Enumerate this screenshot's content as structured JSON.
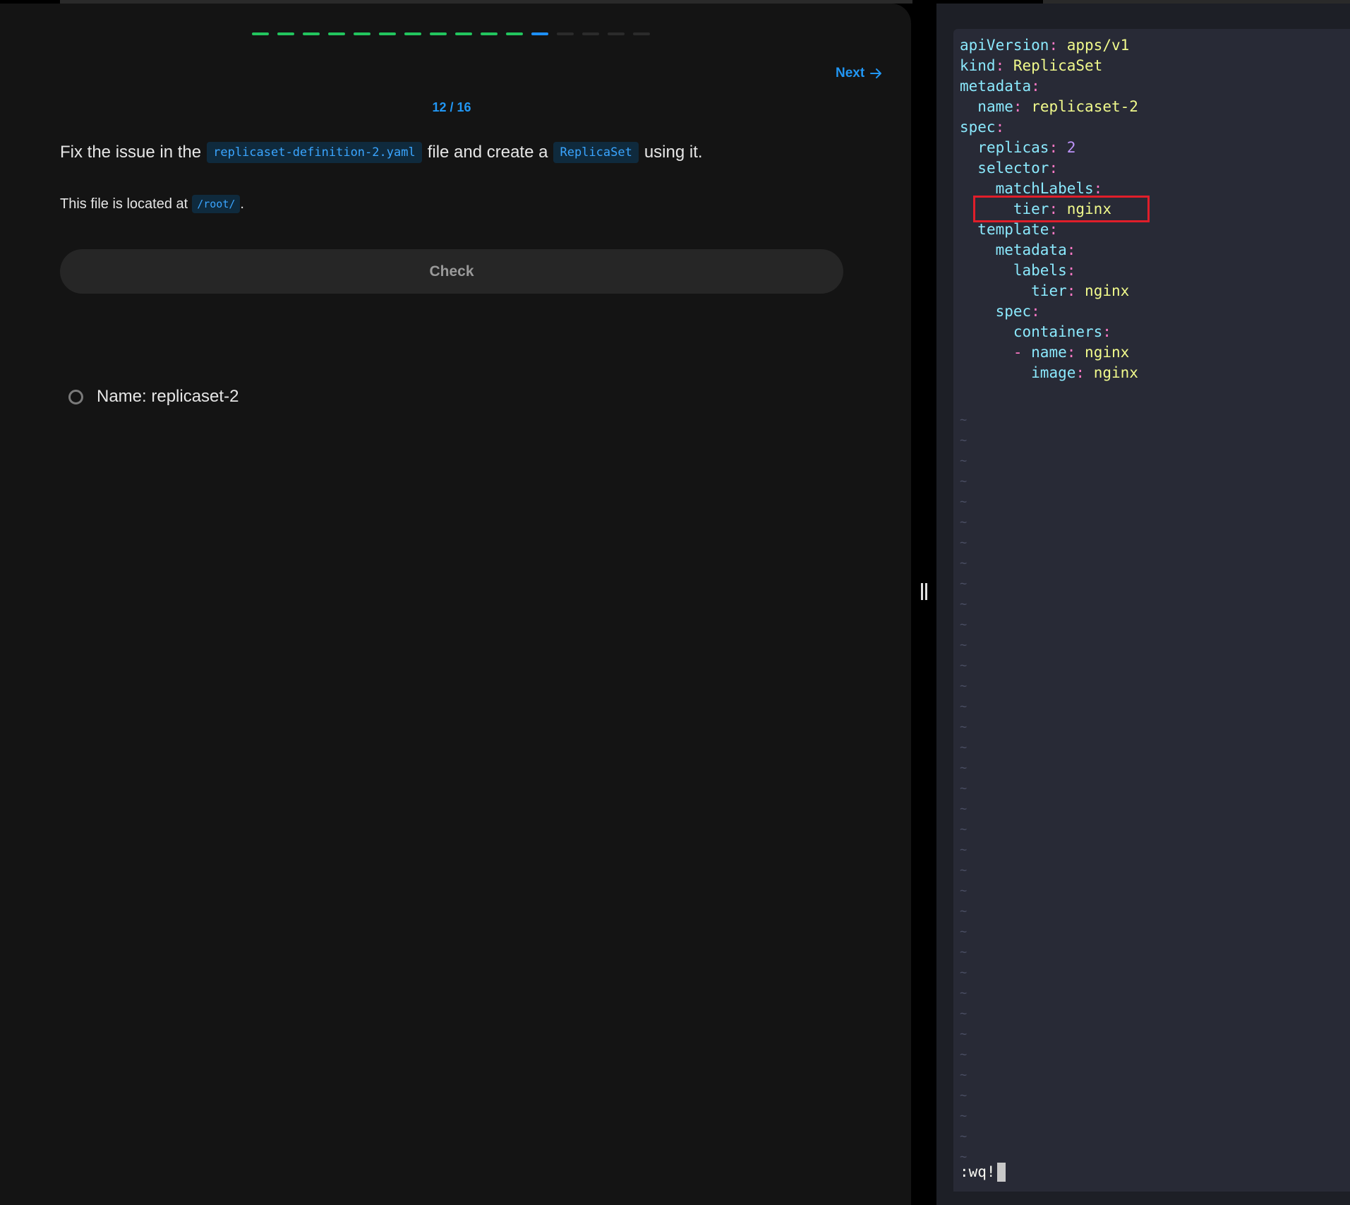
{
  "quiz": {
    "progress": {
      "total": 16,
      "completed": 11,
      "current": 12,
      "colors": {
        "done": "#22c55e",
        "current": "#1e90ff",
        "pending": "#2b2b2b"
      }
    },
    "next_label": "Next",
    "counter": "12 / 16",
    "question": {
      "prefix": "Fix the issue in the",
      "file_code": "replicaset-definition-2.yaml",
      "middle": "file and create a",
      "kind_code": "ReplicaSet",
      "suffix": "using it."
    },
    "location": {
      "prefix": "This file is located at",
      "path_code": "/root/",
      "suffix": "."
    },
    "check_label": "Check",
    "tasks": [
      {
        "label": "Name: replicaset-2",
        "status": "pending"
      }
    ]
  },
  "editor": {
    "lines": [
      {
        "indent": "",
        "key": "apiVersion",
        "value": "apps/v1",
        "value_type": "string"
      },
      {
        "indent": "",
        "key": "kind",
        "value": "ReplicaSet",
        "value_type": "string"
      },
      {
        "indent": "",
        "key": "metadata",
        "value": "",
        "value_type": "none"
      },
      {
        "indent": "  ",
        "key": "name",
        "value": "replicaset-2",
        "value_type": "string"
      },
      {
        "indent": "",
        "key": "spec",
        "value": "",
        "value_type": "none"
      },
      {
        "indent": "  ",
        "key": "replicas",
        "value": "2",
        "value_type": "number"
      },
      {
        "indent": "  ",
        "key": "selector",
        "value": "",
        "value_type": "none"
      },
      {
        "indent": "    ",
        "key": "matchLabels",
        "value": "",
        "value_type": "none"
      },
      {
        "indent": "      ",
        "key": "tier",
        "value": "nginx",
        "value_type": "string"
      },
      {
        "indent": "  ",
        "key": "template",
        "value": "",
        "value_type": "none"
      },
      {
        "indent": "    ",
        "key": "metadata",
        "value": "",
        "value_type": "none"
      },
      {
        "indent": "      ",
        "key": "labels",
        "value": "",
        "value_type": "none"
      },
      {
        "indent": "        ",
        "key": "tier",
        "value": "nginx",
        "value_type": "string"
      },
      {
        "indent": "    ",
        "key": "spec",
        "value": "",
        "value_type": "none"
      },
      {
        "indent": "      ",
        "key": "containers",
        "value": "",
        "value_type": "none"
      },
      {
        "indent": "      ",
        "dash": "- ",
        "key": "name",
        "value": "nginx",
        "value_type": "string"
      },
      {
        "indent": "        ",
        "key": "image",
        "value": "nginx",
        "value_type": "string"
      }
    ],
    "highlighted_line": 9,
    "tilde": "~",
    "tilde_count": 37,
    "command": ":wq!",
    "colors": {
      "background": "#282a36",
      "key": "#8be9fd",
      "punctuation": "#ff79c6",
      "string": "#f1fa8c",
      "number": "#bd93f9",
      "highlight_box": "#e01e2a"
    }
  }
}
